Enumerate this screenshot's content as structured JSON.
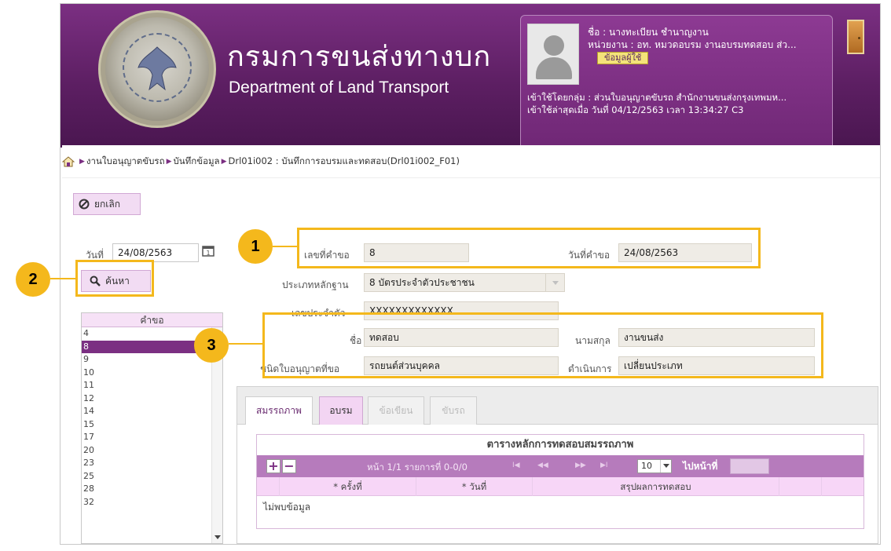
{
  "header": {
    "dept_name_th": "กรมการขนส่งทางบก",
    "dept_name_en": "Department of Land Transport"
  },
  "user": {
    "name_line": "ชื่อ :  นางทะเบียน ชำนาญงาน",
    "unit_line": "หน่วยงาน : อท. หมวดอบรม งานอบรมทดสอบ ส่ว...",
    "info_button": "ข้อมูลผู้ใช้",
    "group_line": "เข้าใช้โดยกลุ่ม : ส่วนใบอนุญาตขับรถ สำนักงานขนส่งกรุงเทพมห...",
    "last_login_line": "เข้าใช้ล่าสุดเมื่อ วันที่ 04/12/2563 เวลา 13:34:27 C3"
  },
  "breadcrumb": {
    "items": [
      "งานใบอนุญาตขับรถ",
      "บันทึกข้อมูล",
      "Drl01i002 : บันทึกการอบรมและทดสอบ(Drl01i002_F01)"
    ]
  },
  "toolbar": {
    "cancel_label": "ยกเลิก"
  },
  "search": {
    "date_label": "วันที่",
    "date_value": "24/08/2563",
    "search_label": "ค้นหา"
  },
  "request_list": {
    "header": "คำขอ",
    "items": [
      "4",
      "8",
      "9",
      "10",
      "11",
      "12",
      "14",
      "15",
      "17",
      "20",
      "23",
      "25",
      "28",
      "32"
    ],
    "selected": "8"
  },
  "form": {
    "req_no_label": "เลขที่คำขอ",
    "req_no_value": "8",
    "req_date_label": "วันที่คำขอ",
    "req_date_value": "24/08/2563",
    "doc_type_label": "ประเภทหลักฐาน",
    "doc_type_value": "8 บัตรประจำตัวประชาชน",
    "id_label": "เลขประจำตัว",
    "id_value": "XXXXXXXXXXXXX",
    "first_name_label": "ชื่อ",
    "first_name_value": "ทดสอบ",
    "last_name_label": "นามสกุล",
    "last_name_value": "งานขนส่ง",
    "license_type_label": "ชนิดใบอนุญาตที่ขอ",
    "license_type_value": "รถยนต์ส่วนบุคคล",
    "action_label": "ดำเนินการ",
    "action_value": "เปลี่ยนประเภท"
  },
  "tabs": [
    "สมรรถภาพ",
    "อบรม",
    "ข้อเขียน",
    "ขับรถ"
  ],
  "grid": {
    "title": "ตารางหลักการทดสอบสมรรถภาพ",
    "pager_info": "หน้า 1/1 รายการที่ 0-0/0",
    "page_size": "10",
    "goto_label": "ไปหน้าที่",
    "columns": [
      "* ครั้งที่",
      "* วันที่",
      "สรุปผลการทดสอบ"
    ],
    "empty_text": "ไม่พบข้อมูล"
  },
  "callouts": [
    "1",
    "2",
    "3"
  ],
  "colors": {
    "brand_purple": "#7b2f82",
    "callout": "#f4b81c"
  }
}
